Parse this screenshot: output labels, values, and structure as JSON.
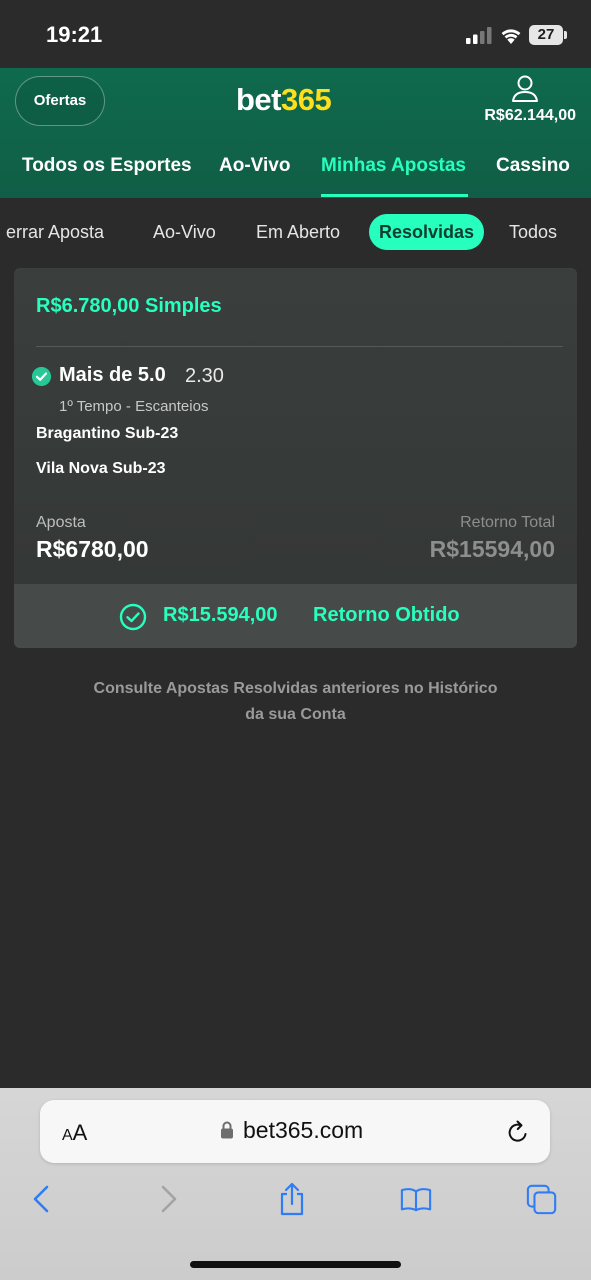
{
  "status_bar": {
    "time": "19:21",
    "battery": "27"
  },
  "header": {
    "offers_label": "Ofertas",
    "logo_part1": "bet",
    "logo_part2": "365",
    "balance": "R$62.144,00"
  },
  "nav": {
    "items": [
      {
        "label": "Todos os Esportes"
      },
      {
        "label": "Ao-Vivo"
      },
      {
        "label": "Minhas Apostas",
        "active": true
      },
      {
        "label": "Cassino"
      }
    ]
  },
  "subtabs": {
    "items": [
      {
        "label": "errar Aposta"
      },
      {
        "label": "Ao-Vivo"
      },
      {
        "label": "Em Aberto"
      },
      {
        "label": "Resolvidas",
        "active": true
      },
      {
        "label": "Todos"
      }
    ]
  },
  "bet": {
    "title": "R$6.780,00 Simples",
    "selection": "Mais de 5.0",
    "odds": "2.30",
    "market": "1º Tempo - Escanteios",
    "team1": "Bragantino Sub-23",
    "team2": "Vila Nova Sub-23",
    "stake_label": "Aposta",
    "stake_value": "R$6780,00",
    "return_label": "Retorno Total",
    "return_value": "R$15594,00",
    "result_amount": "R$15.594,00",
    "result_label": "Retorno Obtido"
  },
  "history_note": {
    "line1": "Consulte Apostas Resolvidas anteriores no Histórico",
    "line2": "da sua Conta"
  },
  "safari": {
    "aa_label": "AA",
    "url": "bet365.com"
  },
  "colors": {
    "accent": "#26ffbe",
    "header_green": "#126e51",
    "logo_yellow": "#ffdf1b",
    "background": "#2b2b2b",
    "ios_blue": "#2f7df6"
  }
}
